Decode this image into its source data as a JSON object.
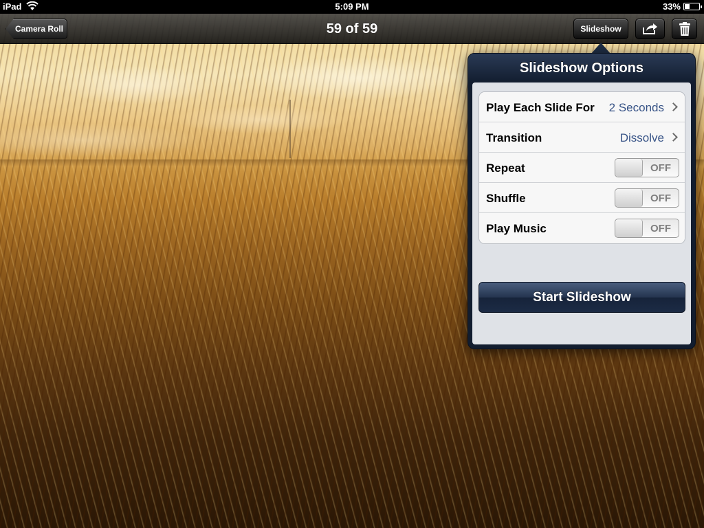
{
  "status_bar": {
    "carrier": "iPad",
    "time": "5:09 PM",
    "battery_percent": "33%",
    "battery_level": 0.33,
    "wifi_icon": "wifi-icon"
  },
  "nav_bar": {
    "back_label": "Camera Roll",
    "title": "59 of 59",
    "slideshow_label": "Slideshow",
    "share_icon": "share-icon",
    "trash_icon": "trash-icon"
  },
  "popover": {
    "title": "Slideshow Options",
    "options": [
      {
        "label": "Play Each Slide For",
        "value": "2 Seconds",
        "kind": "disclosure"
      },
      {
        "label": "Transition",
        "value": "Dissolve",
        "kind": "disclosure"
      },
      {
        "label": "Repeat",
        "value": "OFF",
        "kind": "toggle",
        "on": false
      },
      {
        "label": "Shuffle",
        "value": "OFF",
        "kind": "toggle",
        "on": false
      },
      {
        "label": "Play Music",
        "value": "OFF",
        "kind": "toggle",
        "on": false
      }
    ],
    "start_label": "Start Slideshow"
  },
  "colors": {
    "popover_header": "#1f2f47",
    "value_text": "#385487"
  }
}
